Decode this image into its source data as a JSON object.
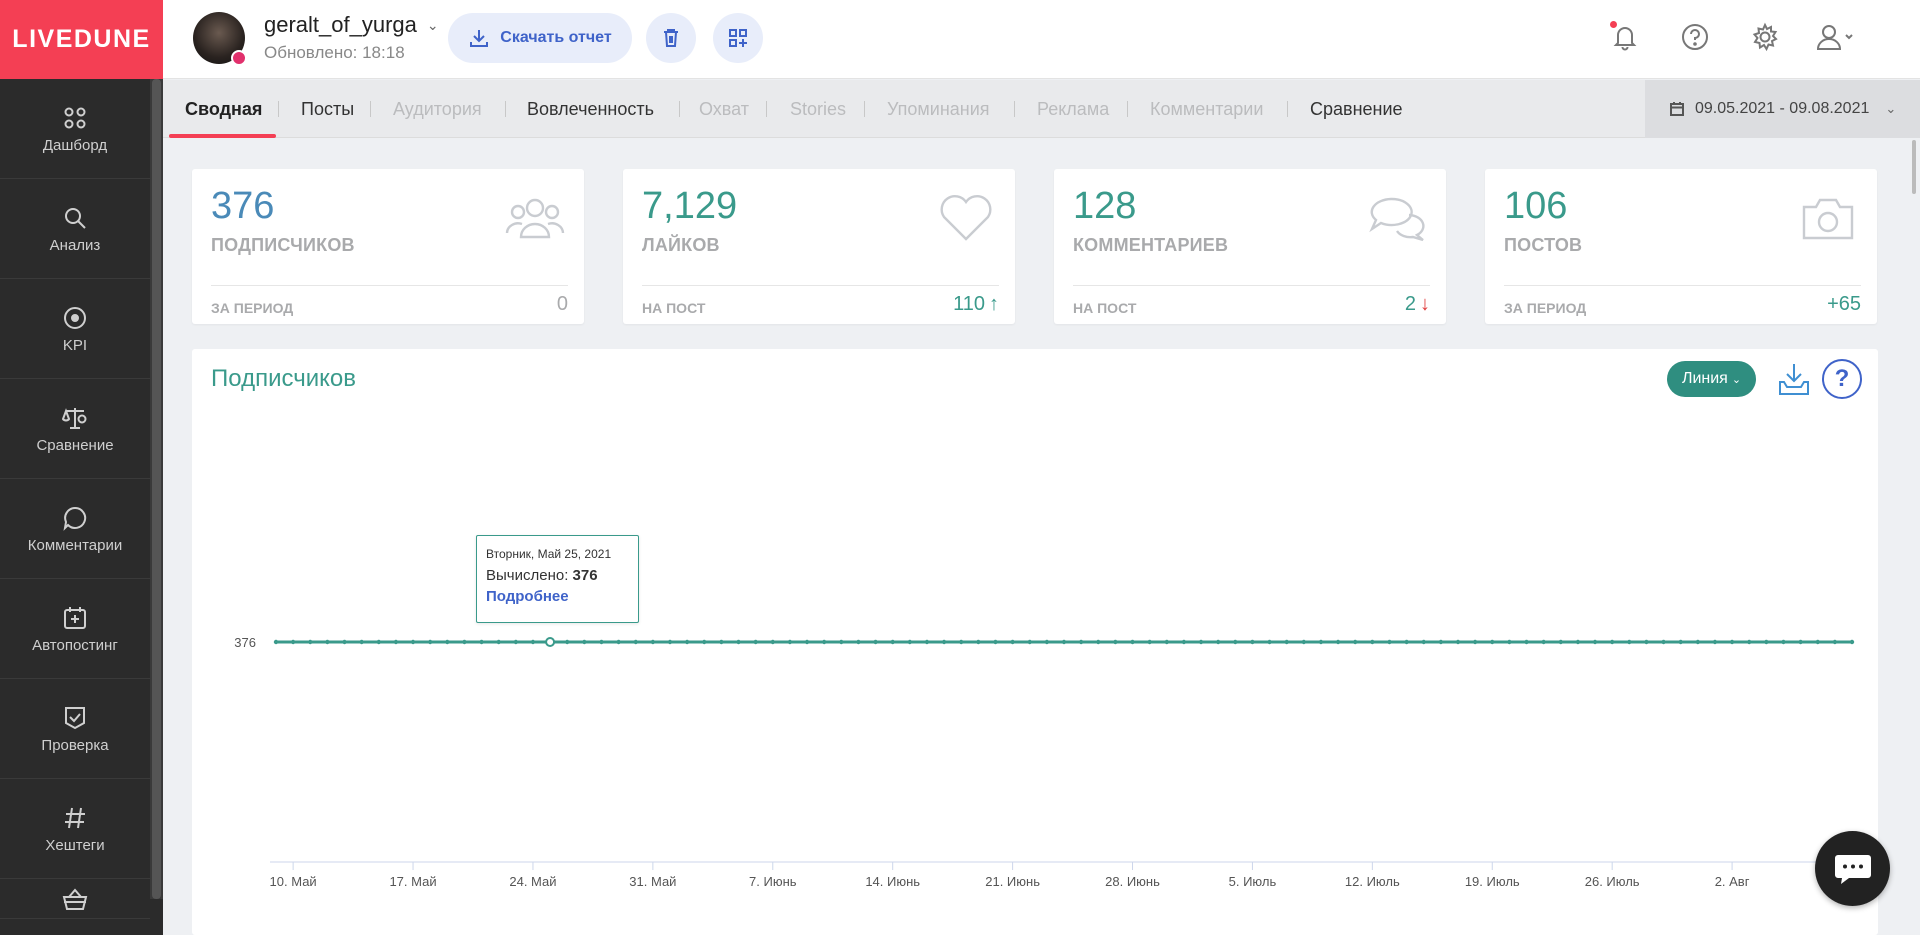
{
  "app": {
    "logo": "LIVEDUNE"
  },
  "sidebar": {
    "items": [
      {
        "label": "Дашборд",
        "icon": "dashboard-icon"
      },
      {
        "label": "Анализ",
        "icon": "search-icon"
      },
      {
        "label": "KPI",
        "icon": "target-icon"
      },
      {
        "label": "Сравнение",
        "icon": "scales-icon"
      },
      {
        "label": "Комментарии",
        "icon": "comment-icon"
      },
      {
        "label": "Автопостинг",
        "icon": "calendar-plus-icon"
      },
      {
        "label": "Проверка",
        "icon": "check-badge-icon"
      },
      {
        "label": "Хештеги",
        "icon": "hashtag-icon"
      },
      {
        "label": "",
        "icon": "basket-icon"
      }
    ]
  },
  "header": {
    "account_name": "geralt_of_yurga",
    "updated": "Обновлено: 18:18",
    "report_button": "Скачать отчет"
  },
  "tabs": [
    {
      "label": "Сводная",
      "state": "active"
    },
    {
      "label": "Посты",
      "state": "normal"
    },
    {
      "label": "Аудитория",
      "state": "disabled"
    },
    {
      "label": "Вовлеченность",
      "state": "normal"
    },
    {
      "label": "Охват",
      "state": "disabled"
    },
    {
      "label": "Stories",
      "state": "disabled"
    },
    {
      "label": "Упоминания",
      "state": "disabled"
    },
    {
      "label": "Реклама",
      "state": "disabled"
    },
    {
      "label": "Комментарии",
      "state": "disabled"
    },
    {
      "label": "Сравнение",
      "state": "normal"
    }
  ],
  "date_range": "09.05.2021 - 09.08.2021",
  "cards": [
    {
      "value": "376",
      "label": "ПОДПИСЧИКОВ",
      "sub": "ЗА ПЕРИОД",
      "sub_value": "0",
      "icon": "users-icon"
    },
    {
      "value": "7,129",
      "label": "ЛАЙКОВ",
      "sub": "НА ПОСТ",
      "sub_value": "110",
      "trend": "up",
      "icon": "heart-icon"
    },
    {
      "value": "128",
      "label": "КОММЕНТАРИЕВ",
      "sub": "НА ПОСТ",
      "sub_value": "2",
      "trend": "down",
      "icon": "comments-icon"
    },
    {
      "value": "106",
      "label": "ПОСТОВ",
      "sub": "ЗА ПЕРИОД",
      "sub_value": "+65",
      "icon": "camera-icon"
    }
  ],
  "chart_panel": {
    "title": "Подписчиков",
    "type_button": "Линия",
    "tooltip": {
      "date": "Вторник, Май 25, 2021",
      "label": "Вычислено:",
      "value": "376",
      "link": "Подробнее"
    }
  },
  "chart_data": {
    "type": "line",
    "title": "Подписчиков",
    "x_tick_labels": [
      "10. Май",
      "17. Май",
      "24. Май",
      "31. Май",
      "7. Июнь",
      "14. Июнь",
      "21. Июнь",
      "28. Июнь",
      "5. Июль",
      "12. Июль",
      "19. Июль",
      "26. Июль",
      "2. Авг"
    ],
    "y_tick_labels": [
      "376"
    ],
    "x_start": "2021-05-09",
    "x_end": "2021-08-09",
    "series": [
      {
        "constant_value": 376,
        "points": 93
      }
    ],
    "highlight": {
      "date": "2021-05-25",
      "value": 376
    },
    "colors": {
      "line": "#3a9a8b"
    }
  },
  "colors": {
    "brand": "#f43f54",
    "accent": "#3a9a8b",
    "link": "#3f63c9"
  }
}
